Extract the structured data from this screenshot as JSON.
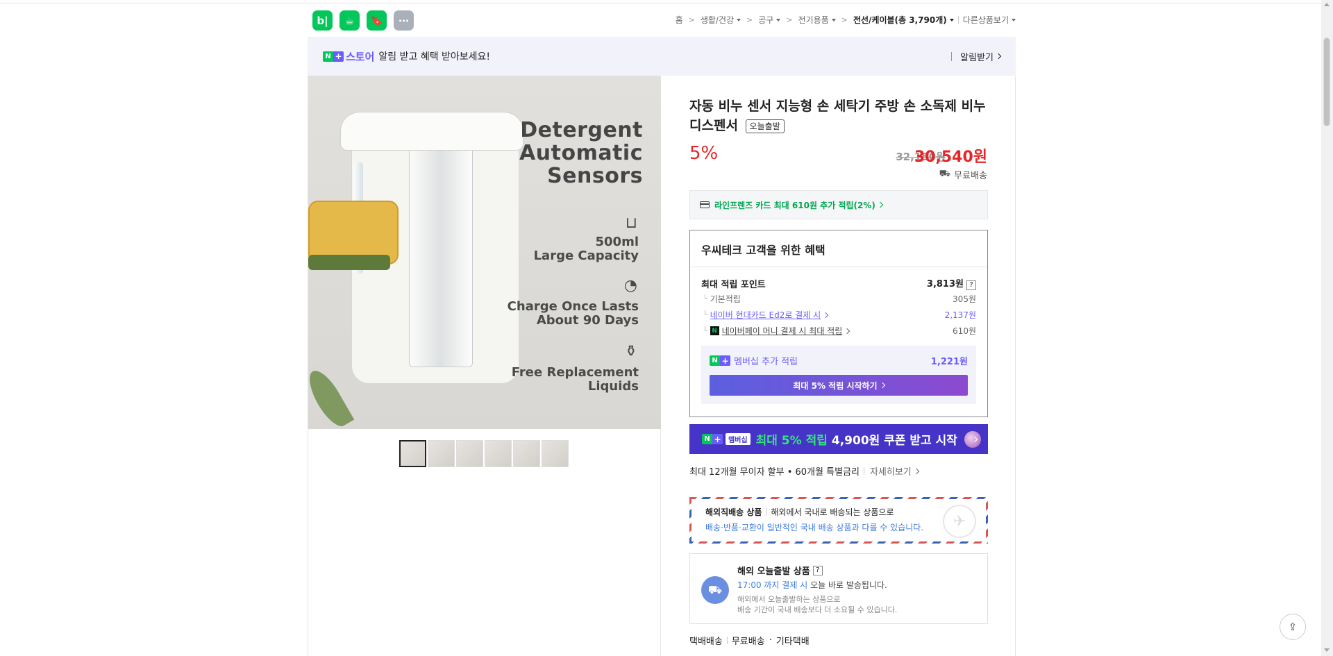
{
  "header": {
    "app_icons": [
      {
        "icon": "blog-icon",
        "label": "b|"
      },
      {
        "icon": "cafe-icon",
        "label": "☕"
      },
      {
        "icon": "bookmark-icon",
        "label": "🔖"
      },
      {
        "icon": "more-icon",
        "label": "⋯"
      }
    ],
    "breadcrumb": [
      {
        "label": "홈",
        "has_dropdown": false
      },
      {
        "label": "생활/건강",
        "has_dropdown": true
      },
      {
        "label": "공구",
        "has_dropdown": true
      },
      {
        "label": "전기용품",
        "has_dropdown": true
      },
      {
        "label": "전선/케이블(총 3,790개)",
        "has_dropdown": true,
        "current": true
      }
    ],
    "other_products": "다른상품보기"
  },
  "alarm_bar": {
    "store_label": "스토어",
    "text": "알림 받고 혜택 받아보세요!",
    "button": "알림받기"
  },
  "product_image": {
    "title": "Detergent Automatic Sensors",
    "features": [
      {
        "icon": "cup-icon",
        "text": "500ml\nLarge Capacity"
      },
      {
        "icon": "clock-icon",
        "text": "Charge Once Lasts\nAbout 90 Days"
      },
      {
        "icon": "bottle-icon",
        "text": "Free Replacement\nLiquids"
      }
    ],
    "thumbnail_count": 6,
    "active_thumbnail": 1
  },
  "product": {
    "title": "자동 비누 센서 지능형 손 세탁기 주방 손 소독제 비누 디스펜서",
    "badge": "오늘출발",
    "discount": "5%",
    "original_price": "32,150원",
    "price": "30,540원",
    "shipping": "무료배송"
  },
  "card_promo": "라인프렌즈 카드 최대 610원 추가 적립(2%)",
  "benefit": {
    "title": "우씨테크 고객을 위한 혜택",
    "max_points_label": "최대 적립 포인트",
    "max_points_value": "3,813원",
    "help": "?",
    "rows": [
      {
        "label": "기본적립",
        "value": "305원"
      },
      {
        "label": "네이버 현대카드 Ed2로 결제 시",
        "value": "2,137원"
      },
      {
        "label": "네이버페이 머니 결제 시 최대 적립",
        "value": "610원"
      }
    ],
    "membership_label": "멤버십 추가 적립",
    "membership_value": "1,221원",
    "start_button": "최대 5% 적립 시작하기"
  },
  "coupon_banner": {
    "tag": "멤버십",
    "text1": "최대 5% 적립",
    "text2": "4,900원 쿠폰 받고 시작"
  },
  "installment": {
    "text": "최대 12개월 무이자 할부 • 60개월 특별금리",
    "more": "자세히보기"
  },
  "airmail": {
    "title": "해외직배송 상품",
    "desc": "해외에서 국내로 배송되는 상품으로",
    "note": "배송·반품·교환이 일반적인 국내 배송 상품과 다를 수 있습니다."
  },
  "overseas": {
    "title": "해외 오늘출발 상품",
    "help": "?",
    "time": "17:00 까지 결제 시",
    "time_suffix": "오늘 바로 발송됩니다.",
    "note1": "해외에서 오늘출발하는 상품으로",
    "note2": "배송 기간이 국내 배송보다 더 소요될 수 있습니다."
  },
  "delivery": {
    "type": "택배배송",
    "fee": "무료배송",
    "carrier": "기타택배"
  },
  "colors": {
    "naver_green": "#03c75a",
    "plus_purple": "#6b5cff",
    "price_red": "#e52528",
    "coupon_bg": "#4634c8"
  }
}
